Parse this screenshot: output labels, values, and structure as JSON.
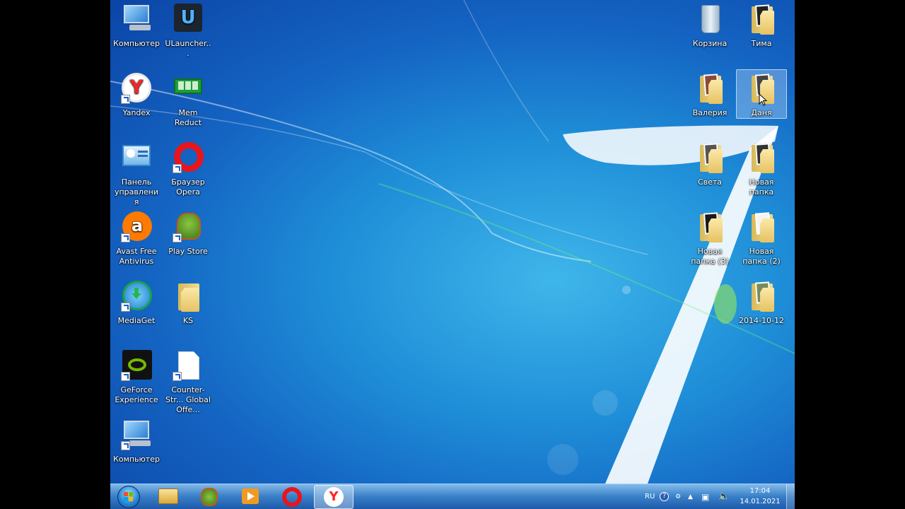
{
  "desktop_left": [
    {
      "name": "computer",
      "label": "Компьютер",
      "icon": "computer-icon",
      "shortcut": false
    },
    {
      "name": "ulauncher",
      "label": "ULauncher...",
      "icon": "ulauncher-icon",
      "shortcut": false
    },
    {
      "name": "yandex",
      "label": "Yandex",
      "icon": "yandex-browser-icon",
      "shortcut": true
    },
    {
      "name": "mem-reduct",
      "label": "Mem Reduct",
      "icon": "memory-chip-icon",
      "shortcut": false
    },
    {
      "name": "control-panel",
      "label": "Панель управления",
      "icon": "control-panel-icon",
      "shortcut": false
    },
    {
      "name": "opera",
      "label": "Браузер Opera",
      "icon": "opera-icon",
      "shortcut": true
    },
    {
      "name": "avast",
      "label": "Avast Free Antivirus",
      "icon": "avast-icon",
      "shortcut": true
    },
    {
      "name": "play-store",
      "label": "Play Store",
      "icon": "play-store-icon",
      "shortcut": true
    },
    {
      "name": "mediaget",
      "label": "MediaGet",
      "icon": "mediaget-icon",
      "shortcut": true
    },
    {
      "name": "ks",
      "label": "KS",
      "icon": "folder-icon",
      "shortcut": false
    },
    {
      "name": "geforce",
      "label": "GeForce Experience",
      "icon": "nvidia-icon",
      "shortcut": true
    },
    {
      "name": "counter-strike",
      "label": "Counter-Str... Global Offe...",
      "icon": "file-icon",
      "shortcut": true
    },
    {
      "name": "computer-2",
      "label": "Компьютер",
      "icon": "computer-icon",
      "shortcut": true
    }
  ],
  "desktop_right": [
    {
      "name": "recycle-bin",
      "label": "Корзина",
      "icon": "recycle-bin-icon"
    },
    {
      "name": "tima",
      "label": "Тима",
      "icon": "folder-icon"
    },
    {
      "name": "valeria",
      "label": "Валерия",
      "icon": "folder-icon"
    },
    {
      "name": "danya",
      "label": "Даня",
      "icon": "folder-icon",
      "selected": true
    },
    {
      "name": "sveta",
      "label": "Света",
      "icon": "folder-icon"
    },
    {
      "name": "new-folder",
      "label": "Новая папка",
      "icon": "folder-icon"
    },
    {
      "name": "new-folder-3",
      "label": "Новая папка (3)",
      "icon": "folder-icon"
    },
    {
      "name": "new-folder-2",
      "label": "Новая папка (2)",
      "icon": "folder-icon"
    },
    {
      "name": "folder-2014",
      "label": "2014-10-12",
      "icon": "folder-icon"
    }
  ],
  "taskbar": {
    "start_icon": "windows-start-icon",
    "pinned": [
      {
        "name": "explorer",
        "icon": "folder-icon"
      },
      {
        "name": "play-store",
        "icon": "play-store-icon"
      },
      {
        "name": "media-player",
        "icon": "media-player-icon"
      },
      {
        "name": "opera",
        "icon": "opera-icon"
      },
      {
        "name": "yandex",
        "icon": "yandex-browser-icon",
        "active": true
      }
    ],
    "tray": {
      "language": "RU",
      "time": "17:04",
      "date": "14.01.2021"
    }
  },
  "colors": {
    "wallpaper_dark": "#0b45a6",
    "wallpaper_light": "#3fb6ea",
    "selection": "#c8e1ff"
  }
}
